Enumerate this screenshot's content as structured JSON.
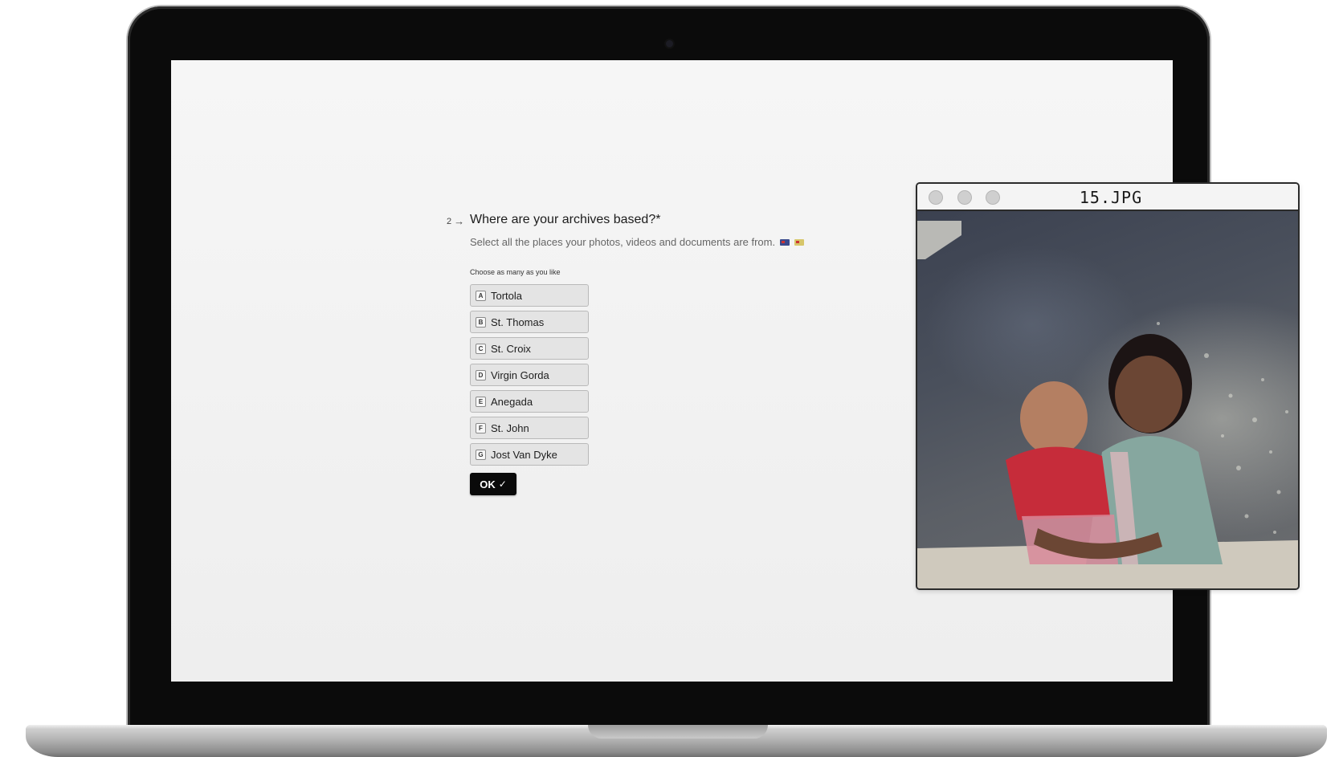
{
  "form": {
    "question_number": "2",
    "question_arrow": "→",
    "question_title": "Where are your archives based?*",
    "subtitle": "Select all the places your photos, videos and documents are from.",
    "hint": "Choose as many as you like",
    "options": [
      {
        "key": "A",
        "label": "Tortola"
      },
      {
        "key": "B",
        "label": "St. Thomas"
      },
      {
        "key": "C",
        "label": "St. Croix"
      },
      {
        "key": "D",
        "label": "Virgin Gorda"
      },
      {
        "key": "E",
        "label": "Anegada"
      },
      {
        "key": "F",
        "label": "St. John"
      },
      {
        "key": "G",
        "label": "Jost Van Dyke"
      }
    ],
    "ok_label": "OK",
    "ok_icon": "✓"
  },
  "viewer": {
    "title": "15.JPG"
  },
  "colors": {
    "screen_bg": "#f4f4f4",
    "option_bg": "#e4e4e4",
    "button_bg": "#0a0a0a",
    "laptop_bezel": "#0b0b0b"
  }
}
